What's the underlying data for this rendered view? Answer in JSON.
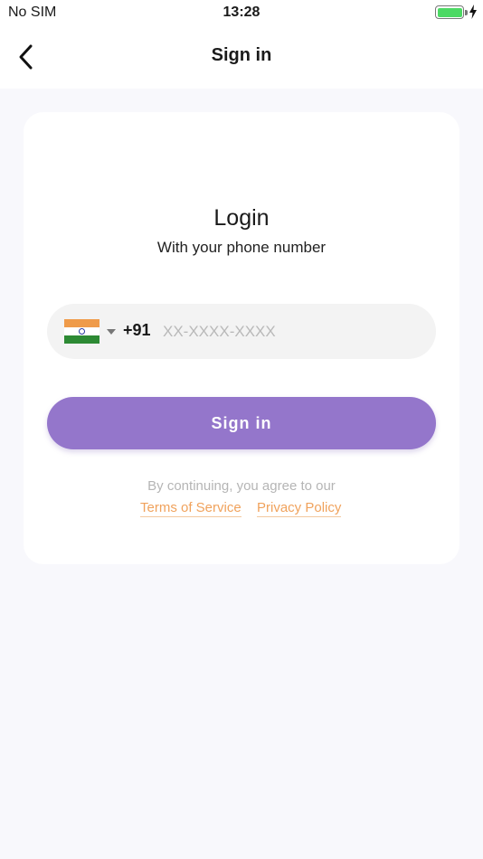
{
  "status_bar": {
    "carrier": "No SIM",
    "time": "13:28",
    "battery_level": 1.0,
    "charging": true,
    "battery_color": "#4cd964"
  },
  "nav": {
    "title": "Sign in",
    "back_icon": "chevron-left-icon"
  },
  "login": {
    "title": "Login",
    "subtitle": "With your phone number"
  },
  "phone": {
    "country_flag": "india-flag-icon",
    "dial_code": "+91",
    "placeholder": "XX-XXXX-XXXX",
    "value": ""
  },
  "signin_button": {
    "label": "Sign in",
    "color": "#9476cb"
  },
  "consent": {
    "text": "By continuing, you agree to our",
    "terms_label": "Terms of Service",
    "privacy_label": "Privacy Policy",
    "link_color": "#f0a25c"
  }
}
